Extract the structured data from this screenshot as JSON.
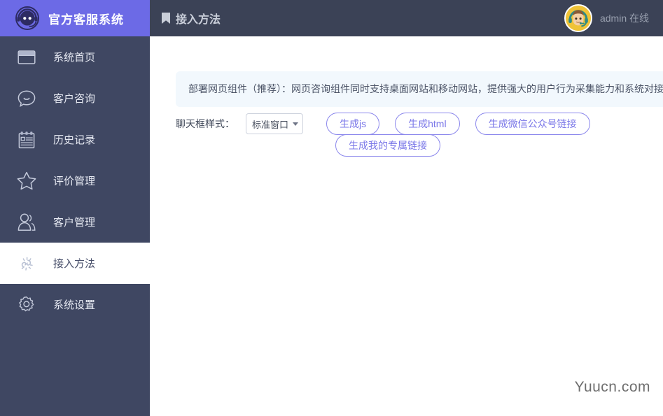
{
  "brand": {
    "logo_icon": "headset-agent-icon",
    "name": "官方客服系统",
    "logo_bg": "#6c6ae6"
  },
  "sidebar": {
    "bg": "#3f4762",
    "active_bg": "#ffffff",
    "items": [
      {
        "icon": "browser-window-icon",
        "label": "系统首页",
        "active": false
      },
      {
        "icon": "chat-bubble-smile-icon",
        "label": "客户咨询",
        "active": false
      },
      {
        "icon": "notepad-records-icon",
        "label": "历史记录",
        "active": false
      },
      {
        "icon": "star-icon",
        "label": "评价管理",
        "active": false
      },
      {
        "icon": "user-group-icon",
        "label": "客户管理",
        "active": false
      },
      {
        "icon": "connect-burst-icon",
        "label": "接入方法",
        "active": true
      },
      {
        "icon": "gear-icon",
        "label": "系统设置",
        "active": false
      }
    ]
  },
  "header": {
    "bg": "#3b4256",
    "bookmark_icon": "bookmark-icon",
    "title": "接入方法",
    "user": {
      "avatar_icon": "agent-avatar-icon",
      "avatar_bg": "#efc337",
      "name": "admin",
      "status": "在线",
      "display": "admin 在线"
    }
  },
  "main": {
    "banner": {
      "bg": "#f2f8fd",
      "text": "部署网页组件（推荐）：网页咨询组件同时支持桌面网站和移动网站，提供强大的用户行为采集能力和系统对接能力"
    },
    "form": {
      "label": "聊天框样式：",
      "select": {
        "value": "标准窗口",
        "caret_icon": "chevron-down-icon",
        "options": [
          "标准窗口"
        ]
      }
    },
    "buttons_row1": [
      {
        "label": "生成js",
        "name": "generate-js-button"
      },
      {
        "label": "生成html",
        "name": "generate-html-button"
      },
      {
        "label": "生成微信公众号链接",
        "name": "generate-wechat-link-button"
      }
    ],
    "buttons_row2": [
      {
        "label": "生成我的专属链接",
        "name": "generate-my-link-button"
      }
    ],
    "accent_color": "#7a77e8"
  },
  "watermark": "Yuucn.com"
}
